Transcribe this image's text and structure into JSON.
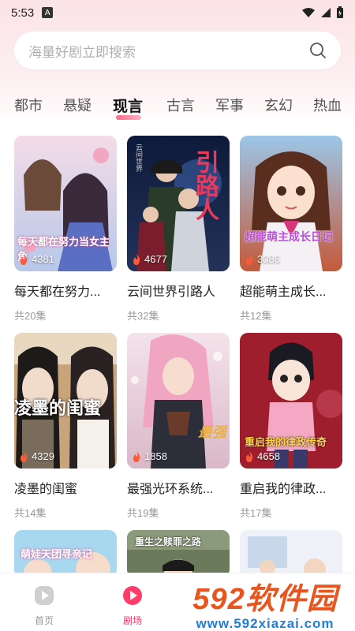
{
  "status_bar": {
    "time": "5:53",
    "app_badge": "A"
  },
  "search": {
    "placeholder": "海量好剧立即搜索"
  },
  "tabs": [
    {
      "label": "都市",
      "active": false
    },
    {
      "label": "悬疑",
      "active": false
    },
    {
      "label": "现言",
      "active": true
    },
    {
      "label": "古言",
      "active": false
    },
    {
      "label": "军事",
      "active": false
    },
    {
      "label": "玄幻",
      "active": false
    },
    {
      "label": "热血",
      "active": false
    }
  ],
  "dramas": [
    {
      "title": "每天都在努力...",
      "episodes": "共20集",
      "views": "4381",
      "cover_text": "每天都在努力当女主角"
    },
    {
      "title": "云间世界引路人",
      "episodes": "共32集",
      "views": "4677",
      "cover_text": "引路人"
    },
    {
      "title": "超能萌主成长...",
      "episodes": "共12集",
      "views": "3086",
      "cover_text": "超能萌主成长日记"
    },
    {
      "title": "凌墨的闺蜜",
      "episodes": "共14集",
      "views": "4329",
      "cover_text": "凌墨的闺蜜"
    },
    {
      "title": "最强光环系统...",
      "episodes": "共19集",
      "views": "1858",
      "cover_text": "最强"
    },
    {
      "title": "重启我的律政...",
      "episodes": "共17集",
      "views": "4658",
      "cover_text": "重启我的律政传奇"
    },
    {
      "title": "",
      "episodes": "",
      "views": "",
      "cover_text": "萌娃天团寻亲记"
    },
    {
      "title": "",
      "episodes": "",
      "views": "",
      "cover_text": "重生之赎罪之路"
    },
    {
      "title": "",
      "episodes": "",
      "views": "",
      "cover_text": ""
    }
  ],
  "bottom_nav": [
    {
      "label": "首页",
      "active": false
    },
    {
      "label": "剧场",
      "active": true
    }
  ],
  "watermark": {
    "brand": "592软件园",
    "url": "www.592xiazai.com"
  },
  "colors": {
    "accent": "#ff4d6d",
    "tab_underline": "#ff6b8a",
    "inactive": "#999999"
  }
}
